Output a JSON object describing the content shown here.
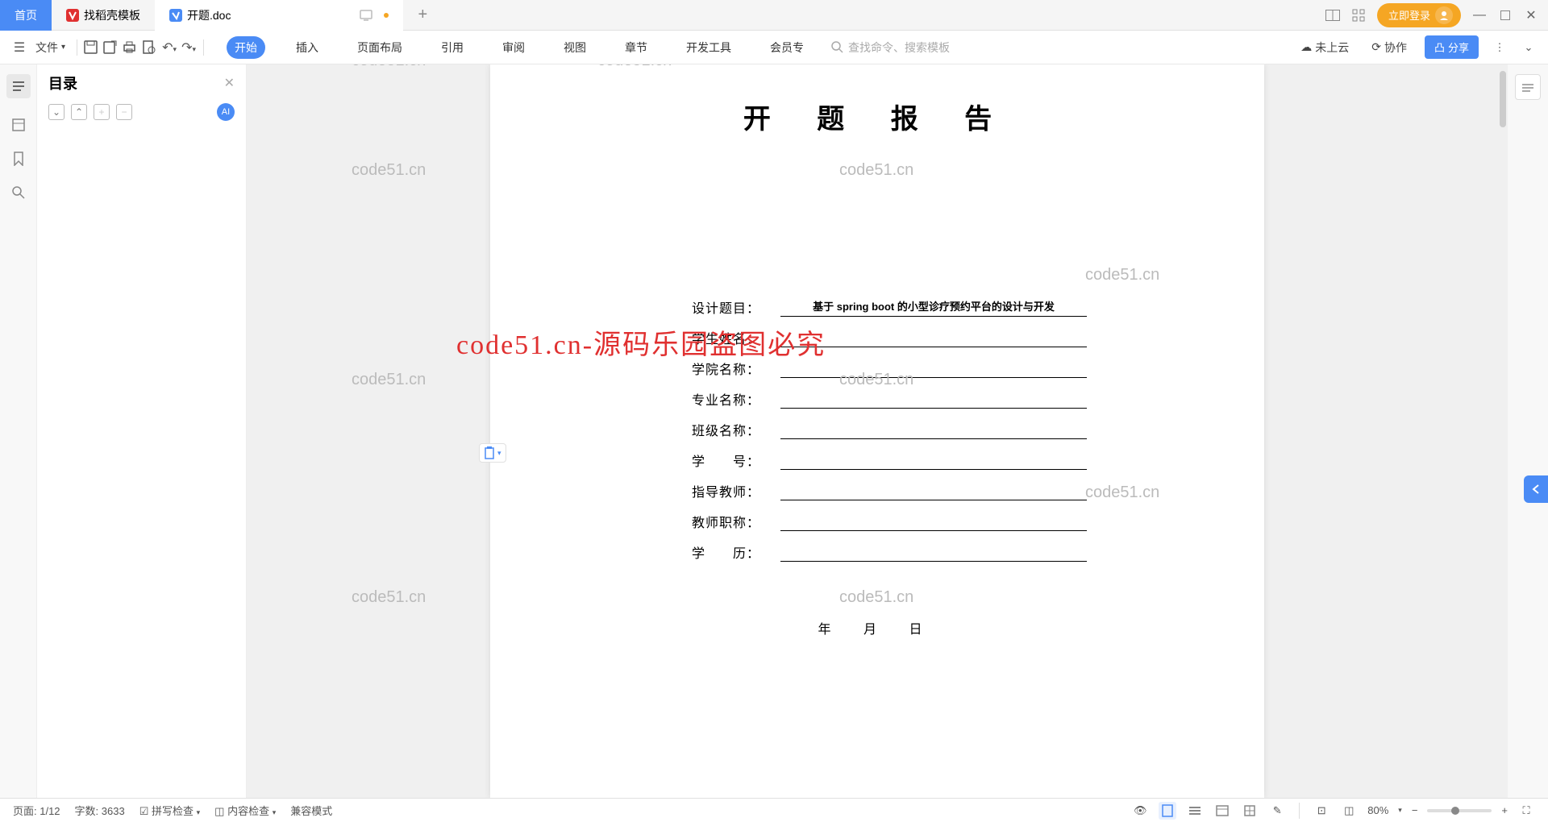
{
  "tabs": {
    "home": "首页",
    "template": "找稻壳模板",
    "doc": "开题.doc"
  },
  "titlebar": {
    "login": "立即登录"
  },
  "toolbar": {
    "file": "文件",
    "menus": [
      "开始",
      "插入",
      "页面布局",
      "引用",
      "审阅",
      "视图",
      "章节",
      "开发工具",
      "会员专"
    ],
    "search_placeholder": "查找命令、搜索模板",
    "cloud": "未上云",
    "collab": "协作",
    "share": "分享"
  },
  "outline": {
    "title": "目录"
  },
  "document": {
    "title": "开 题 报 告",
    "fields": [
      {
        "label": "设计题目：",
        "value": "基于 spring boot 的小型诊疗预约平台的设计与开发"
      },
      {
        "label": "学生姓名：",
        "value": ""
      },
      {
        "label": "学院名称：",
        "value": ""
      },
      {
        "label": "专业名称：",
        "value": ""
      },
      {
        "label": "班级名称：",
        "value": ""
      },
      {
        "label": "学　　号：",
        "value": ""
      },
      {
        "label": "指导教师：",
        "value": ""
      },
      {
        "label": "教师职称：",
        "value": ""
      },
      {
        "label": "学　　历：",
        "value": ""
      }
    ],
    "date": "年 月 日"
  },
  "watermarks": {
    "text": "code51.cn",
    "red": "code51.cn-源码乐园盗图必究"
  },
  "statusbar": {
    "page": "页面: 1/12",
    "words": "字数: 3633",
    "spellcheck": "拼写检查",
    "contentcheck": "内容检查",
    "compat": "兼容模式",
    "zoom": "80%"
  }
}
